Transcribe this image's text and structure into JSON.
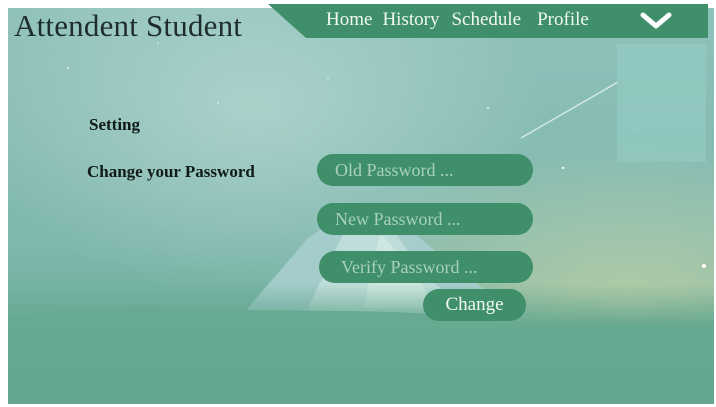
{
  "app": {
    "title": "Attendent Student"
  },
  "nav": {
    "items": [
      {
        "label": "Home"
      },
      {
        "label": "History"
      },
      {
        "label": "Schedule"
      },
      {
        "label": "Profile"
      }
    ],
    "menu_icon": "chevron-down-icon"
  },
  "settings": {
    "heading": "Setting",
    "section_label": "Change your Password",
    "old_password": {
      "value": "",
      "placeholder": "Old Password ..."
    },
    "new_password": {
      "value": "",
      "placeholder": "New Password ..."
    },
    "verify_password": {
      "value": "",
      "placeholder": "Verify Password ..."
    },
    "change_button": "Change"
  },
  "colors": {
    "accent": "#3f8f6a",
    "background": "#86bcb4",
    "title_text": "#1f2e2c"
  }
}
